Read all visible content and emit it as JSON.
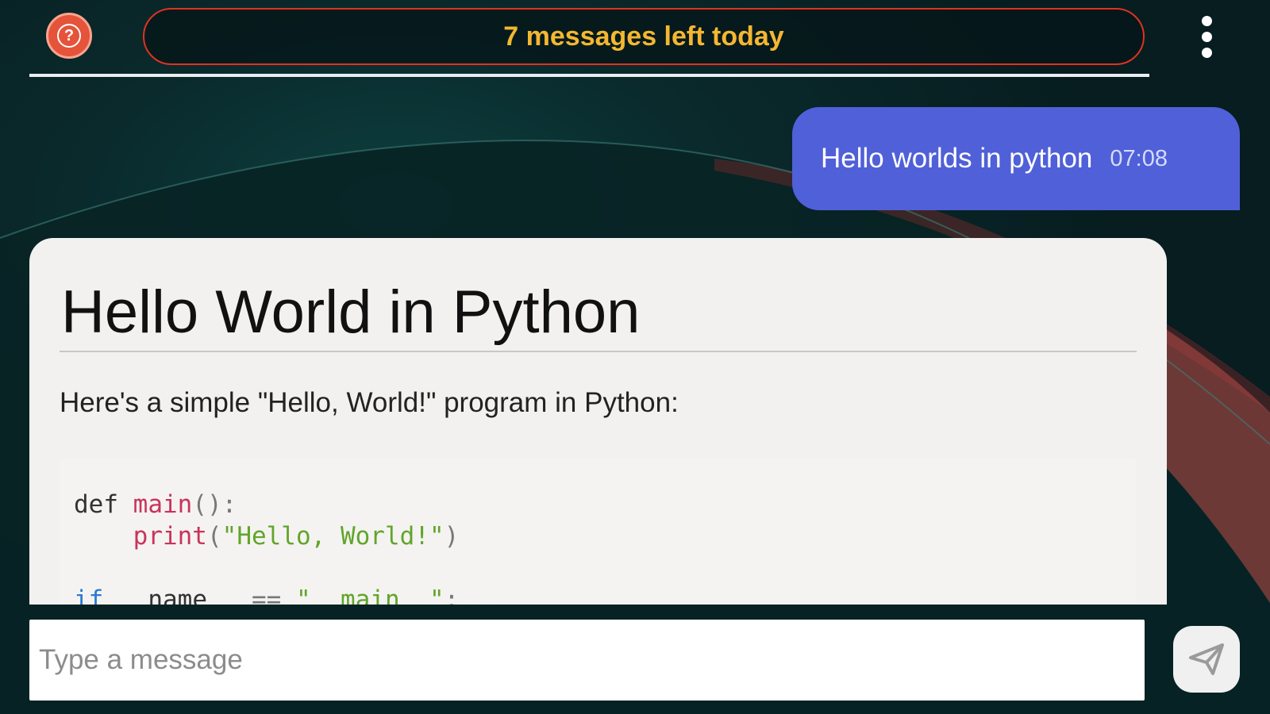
{
  "header": {
    "quota_text": "7 messages left today",
    "help_icon": "help-question-icon",
    "menu_icon": "more-vertical-icon"
  },
  "messages": [
    {
      "role": "user",
      "text": "Hello worlds in python",
      "time": "07:08"
    }
  ],
  "response": {
    "title": "Hello World in Python",
    "intro": "Here's a simple \"Hello, World!\" program in Python:",
    "code_lines": [
      "def main():",
      "    print(\"Hello, World!\")",
      "",
      "if __name__ == \"__main__\":"
    ]
  },
  "composer": {
    "placeholder": "Type a message",
    "send_icon": "send-icon"
  },
  "colors": {
    "accent": "#5060d8",
    "quota_border": "#e0321f",
    "quota_text": "#f4b731",
    "help_button": "#e5533a"
  }
}
